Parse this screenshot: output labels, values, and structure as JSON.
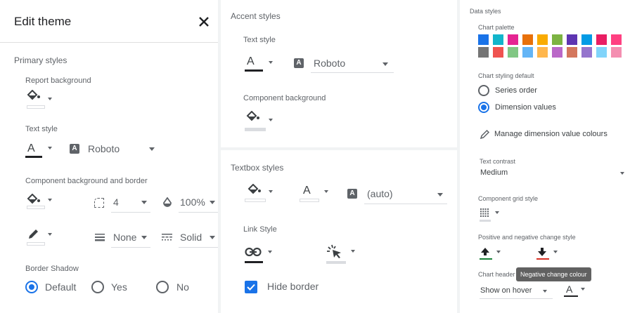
{
  "edit_theme": {
    "title": "Edit theme",
    "primary_styles": {
      "heading": "Primary styles",
      "report_background_label": "Report background",
      "text_style_label": "Text style",
      "font": "Roboto",
      "component_bg_border_label": "Component background and border",
      "border_radius": "4",
      "opacity": "100%",
      "border_weight": "None",
      "border_style": "Solid",
      "border_shadow_label": "Border Shadow",
      "shadow_options": [
        "Default",
        "Yes",
        "No"
      ],
      "shadow_selected": "Default"
    }
  },
  "accent_styles": {
    "heading": "Accent styles",
    "text_style_label": "Text style",
    "font": "Roboto",
    "component_bg_label": "Component background"
  },
  "textbox_styles": {
    "heading": "Textbox styles",
    "font": "(auto)",
    "link_style_label": "Link Style",
    "hide_border_label": "Hide border",
    "hide_border_checked": true
  },
  "data_styles": {
    "heading": "Data styles",
    "chart_palette_label": "Chart palette",
    "palette": [
      "#1a73e8",
      "#12b5cb",
      "#e52592",
      "#e8710a",
      "#f9ab00",
      "#7cb342",
      "#5e35b1",
      "#039be5",
      "#e91e63",
      "#ff4081",
      "#757575",
      "#ef5350",
      "#81c784",
      "#64b5f6",
      "#ffb74d",
      "#ba68c8",
      "#d4775d",
      "#9575cd",
      "#81d4fa",
      "#f48fb1"
    ],
    "chart_styling_default_label": "Chart styling default",
    "styling_options": [
      "Series order",
      "Dimension values"
    ],
    "styling_selected": "Dimension values",
    "manage_colours_label": "Manage dimension value colours",
    "text_contrast_label": "Text contrast",
    "text_contrast_value": "Medium",
    "grid_style_label": "Component grid style",
    "change_style_label": "Positive and negative change style",
    "tooltip": "Negative change colour",
    "chart_header_label": "Chart header",
    "chart_header_value": "Show on hover",
    "colors": {
      "positive": "#188038",
      "negative": "#d93025",
      "accent": "#1a73e8"
    }
  }
}
